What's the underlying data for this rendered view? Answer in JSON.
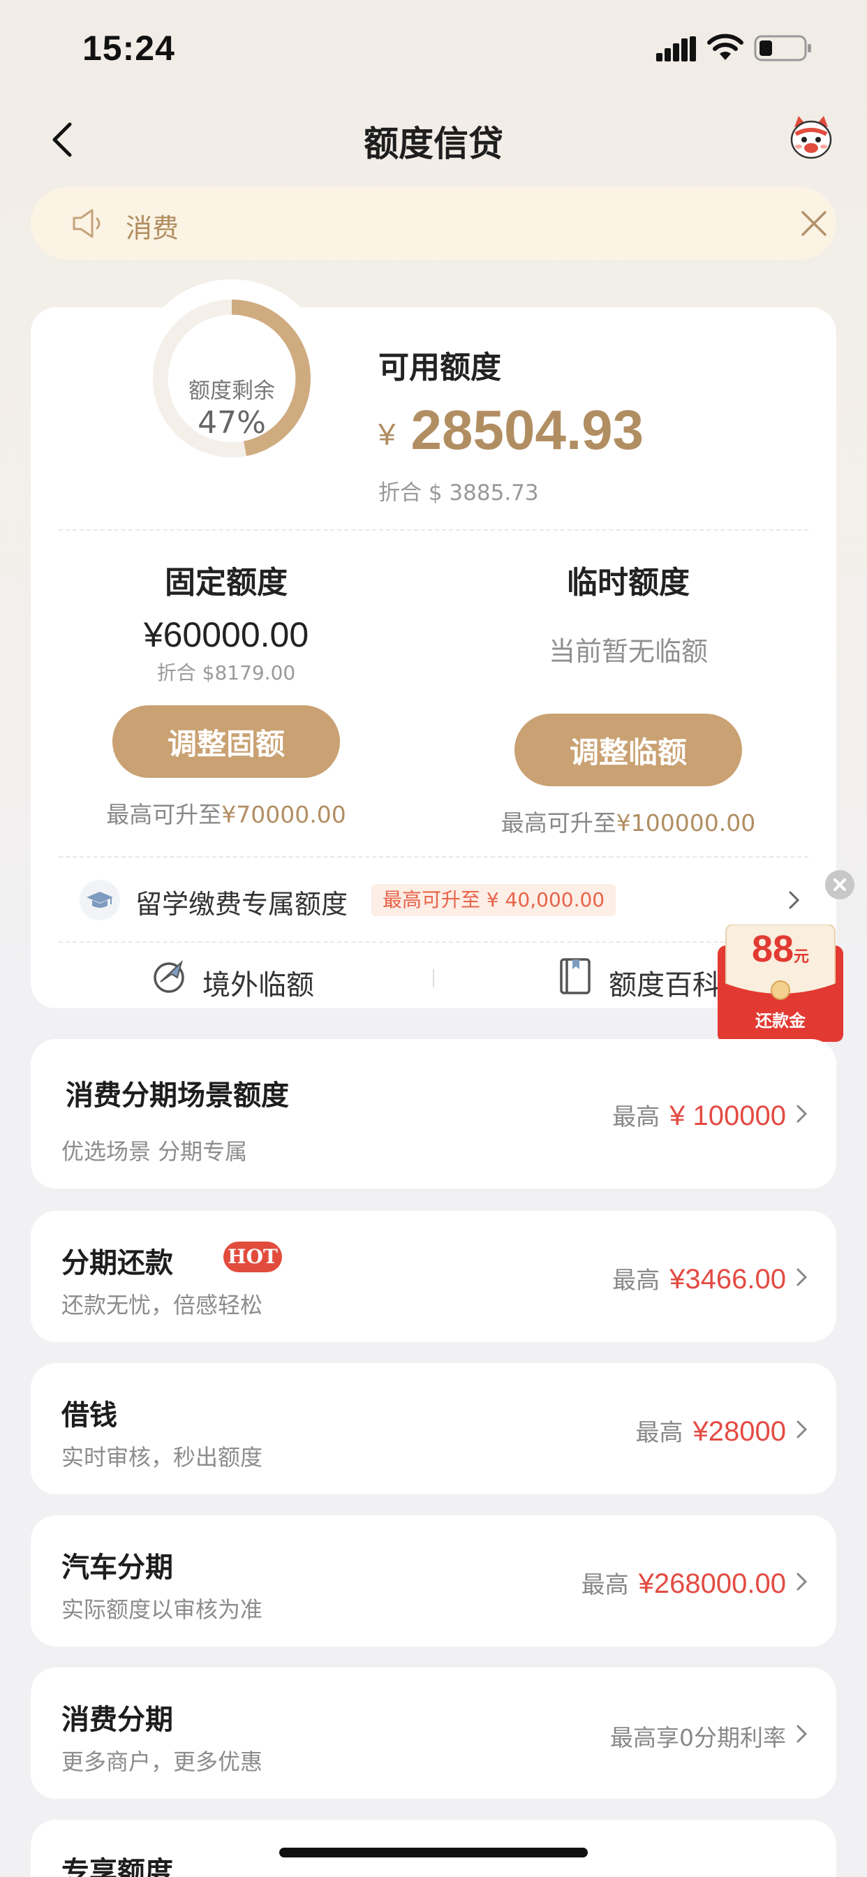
{
  "status_bar": {
    "time": "15:24"
  },
  "nav": {
    "title": "额度信贷"
  },
  "notice": {
    "text": "消费"
  },
  "quota": {
    "ring_label": "额度剩余",
    "ring_percent_text": "47%",
    "ring_fraction": 0.47,
    "available_title": "可用额度",
    "currency": "¥",
    "available_amount": "28504.93",
    "available_usd": "折合 $ 3885.73",
    "fixed": {
      "title": "固定额度",
      "amount": "¥60000.00",
      "usd": "折合 $8179.00",
      "button": "调整固额",
      "max_prefix": "最高可升至",
      "max_amount": "¥70000.00"
    },
    "temp": {
      "title": "临时额度",
      "none_text": "当前暂无临额",
      "button": "调整临额",
      "max_prefix": "最高可升至",
      "max_amount": "¥100000.00"
    },
    "study": {
      "label": "留学缴费专属额度",
      "badge": "最高可升至 ¥ 40,000.00"
    },
    "tools": {
      "left": "境外临额",
      "right": "额度百科"
    }
  },
  "red_packet": {
    "amount": "88",
    "unit": "元",
    "label": "还款金"
  },
  "cards": [
    {
      "title": "消费分期场景额度",
      "subtitle": "优选场景 分期专属",
      "max_label": "最高",
      "value": "¥ 100000"
    },
    {
      "title": "分期还款",
      "badge": "HOT",
      "subtitle": "还款无忧，倍感轻松",
      "max_label": "最高",
      "value": "¥3466.00"
    },
    {
      "title": "借钱",
      "subtitle": "实时审核，秒出额度",
      "max_label": "最高",
      "value": "¥28000"
    },
    {
      "title": "汽车分期",
      "subtitle": "实际额度以审核为准",
      "max_label": "最高",
      "value": "¥268000.00"
    },
    {
      "title": "消费分期",
      "subtitle": "更多商户，更多优惠",
      "right_text": "最高享0分期利率"
    },
    {
      "title": "专享额度"
    }
  ],
  "colors": {
    "gold": "#b18e62",
    "button_gold": "#c9a172",
    "red": "#e34b43"
  }
}
